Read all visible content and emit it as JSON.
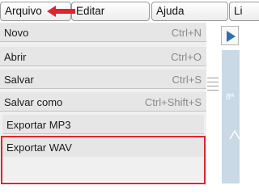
{
  "menubar": {
    "items": [
      {
        "label": "Arquivo"
      },
      {
        "label": "Editar"
      },
      {
        "label": "Ajuda"
      },
      {
        "label": "Li"
      }
    ]
  },
  "dropdown": {
    "items": [
      {
        "label": "Novo",
        "shortcut": "Ctrl+N"
      },
      {
        "label": "Abrir",
        "shortcut": "Ctrl+O"
      },
      {
        "label": "Salvar",
        "shortcut": "Ctrl+S"
      },
      {
        "label": "Salvar como",
        "shortcut": "Ctrl+Shift+S"
      },
      {
        "label": "Exportar MP3"
      },
      {
        "label": "Exportar WAV"
      }
    ]
  },
  "side": {
    "ordinal": "8ª",
    "play_icon": "play-icon"
  },
  "annotation": {
    "arrow_color": "#e0242b",
    "highlight_color": "#e0242b"
  }
}
